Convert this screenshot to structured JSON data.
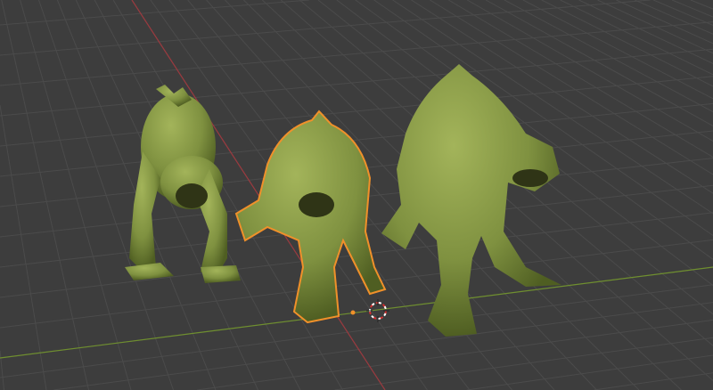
{
  "viewport": {
    "background_color": "#3d3d3d",
    "grid_color": "#4b4b4b",
    "x_axis_color": "#9a3a3f",
    "y_axis_color": "#6f8f2f",
    "model_color": "#7f9140",
    "model_shadow_color": "#4f5e22",
    "selection_outline_color": "#f0902a",
    "cursor_color": "#d03030"
  }
}
